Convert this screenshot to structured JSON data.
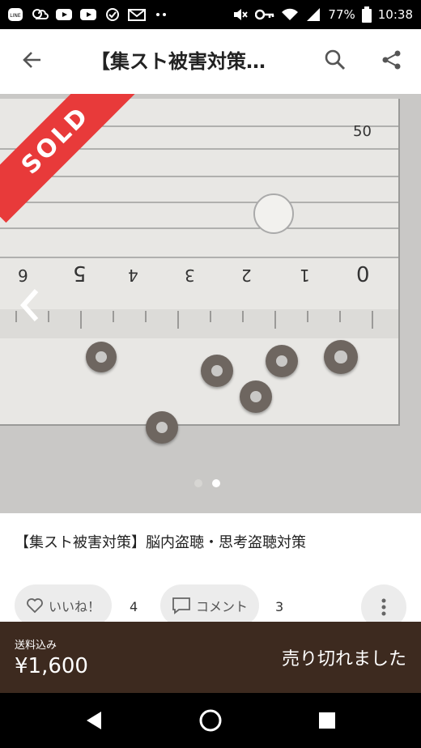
{
  "status_bar": {
    "battery_pct": "77%",
    "time": "10:38"
  },
  "app_bar": {
    "title": "【集スト被害対策…"
  },
  "photo": {
    "badge": "SOLD",
    "ruler_numbers": [
      "50",
      "0",
      "1",
      "2",
      "3",
      "4",
      "5",
      "6"
    ],
    "pages": 2,
    "active_page": 2
  },
  "product": {
    "title": "【集スト被害対策】脳内盗聴・思考盗聴対策"
  },
  "actions": {
    "like_label": "いいね！",
    "like_count": "4",
    "comment_label": "コメント",
    "comment_count": "3"
  },
  "buy_bar": {
    "shipping": "送料込み",
    "price": "¥1,600",
    "status": "売り切れました"
  },
  "colors": {
    "sold_red": "#e83a3a",
    "buy_bar_bg": "#3d2a1f"
  }
}
